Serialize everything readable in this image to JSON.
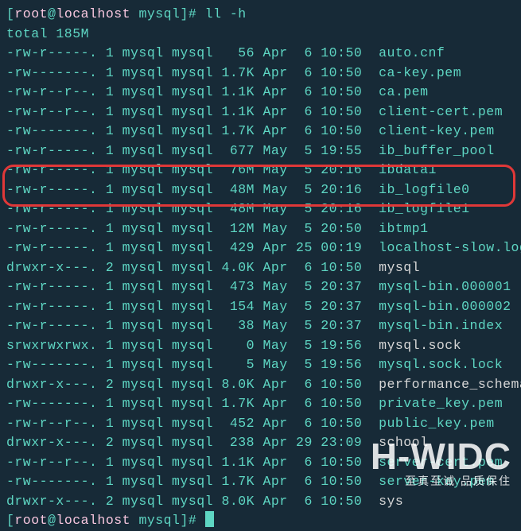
{
  "prompt": {
    "open": "[",
    "user": "root",
    "at": "@",
    "host": "localhost",
    "path": " mysql",
    "close": "]#",
    "command": " ll -h"
  },
  "total_line": "total 185M",
  "rows": [
    {
      "perm": "-rw-r-----.",
      "n": "1",
      "u": "mysql",
      "g": "mysql",
      "size": "  56",
      "dt": "Apr  6 10:50",
      "name": "auto.cnf",
      "cls": "fname-plain"
    },
    {
      "perm": "-rw-------.",
      "n": "1",
      "u": "mysql",
      "g": "mysql",
      "size": "1.7K",
      "dt": "Apr  6 10:50",
      "name": "ca-key.pem",
      "cls": "fname-plain"
    },
    {
      "perm": "-rw-r--r--.",
      "n": "1",
      "u": "mysql",
      "g": "mysql",
      "size": "1.1K",
      "dt": "Apr  6 10:50",
      "name": "ca.pem",
      "cls": "fname-plain"
    },
    {
      "perm": "-rw-r--r--.",
      "n": "1",
      "u": "mysql",
      "g": "mysql",
      "size": "1.1K",
      "dt": "Apr  6 10:50",
      "name": "client-cert.pem",
      "cls": "fname-plain"
    },
    {
      "perm": "-rw-------.",
      "n": "1",
      "u": "mysql",
      "g": "mysql",
      "size": "1.7K",
      "dt": "Apr  6 10:50",
      "name": "client-key.pem",
      "cls": "fname-plain"
    },
    {
      "perm": "-rw-r-----.",
      "n": "1",
      "u": "mysql",
      "g": "mysql",
      "size": " 677",
      "dt": "May  5 19:55",
      "name": "ib_buffer_pool",
      "cls": "fname-plain"
    },
    {
      "perm": "-rw-r-----.",
      "n": "1",
      "u": "mysql",
      "g": "mysql",
      "size": " 76M",
      "dt": "May  5 20:16",
      "name": "ibdata1",
      "cls": "fname-plain"
    },
    {
      "perm": "-rw-r-----.",
      "n": "1",
      "u": "mysql",
      "g": "mysql",
      "size": " 48M",
      "dt": "May  5 20:16",
      "name": "ib_logfile0",
      "cls": "fname-plain"
    },
    {
      "perm": "-rw-r-----.",
      "n": "1",
      "u": "mysql",
      "g": "mysql",
      "size": " 48M",
      "dt": "May  5 20:16",
      "name": "ib_logfile1",
      "cls": "fname-plain"
    },
    {
      "perm": "-rw-r-----.",
      "n": "1",
      "u": "mysql",
      "g": "mysql",
      "size": " 12M",
      "dt": "May  5 20:50",
      "name": "ibtmp1",
      "cls": "fname-plain"
    },
    {
      "perm": "-rw-r-----.",
      "n": "1",
      "u": "mysql",
      "g": "mysql",
      "size": " 429",
      "dt": "Apr 25 00:19",
      "name": "localhost-slow.log",
      "cls": "fname-plain"
    },
    {
      "perm": "drwxr-x---.",
      "n": "2",
      "u": "mysql",
      "g": "mysql",
      "size": "4.0K",
      "dt": "Apr  6 10:50",
      "name": "mysql",
      "cls": "fname-dir"
    },
    {
      "perm": "-rw-r-----.",
      "n": "1",
      "u": "mysql",
      "g": "mysql",
      "size": " 473",
      "dt": "May  5 20:37",
      "name": "mysql-bin.000001",
      "cls": "fname-plain"
    },
    {
      "perm": "-rw-r-----.",
      "n": "1",
      "u": "mysql",
      "g": "mysql",
      "size": " 154",
      "dt": "May  5 20:37",
      "name": "mysql-bin.000002",
      "cls": "fname-plain"
    },
    {
      "perm": "-rw-r-----.",
      "n": "1",
      "u": "mysql",
      "g": "mysql",
      "size": "  38",
      "dt": "May  5 20:37",
      "name": "mysql-bin.index",
      "cls": "fname-plain"
    },
    {
      "perm": "srwxrwxrwx.",
      "n": "1",
      "u": "mysql",
      "g": "mysql",
      "size": "   0",
      "dt": "May  5 19:56",
      "name": "mysql.sock",
      "cls": "fname-sock"
    },
    {
      "perm": "-rw-------.",
      "n": "1",
      "u": "mysql",
      "g": "mysql",
      "size": "   5",
      "dt": "May  5 19:56",
      "name": "mysql.sock.lock",
      "cls": "fname-plain"
    },
    {
      "perm": "drwxr-x---.",
      "n": "2",
      "u": "mysql",
      "g": "mysql",
      "size": "8.0K",
      "dt": "Apr  6 10:50",
      "name": "performance_schema",
      "cls": "fname-dir"
    },
    {
      "perm": "-rw-------.",
      "n": "1",
      "u": "mysql",
      "g": "mysql",
      "size": "1.7K",
      "dt": "Apr  6 10:50",
      "name": "private_key.pem",
      "cls": "fname-plain"
    },
    {
      "perm": "-rw-r--r--.",
      "n": "1",
      "u": "mysql",
      "g": "mysql",
      "size": " 452",
      "dt": "Apr  6 10:50",
      "name": "public_key.pem",
      "cls": "fname-plain"
    },
    {
      "perm": "drwxr-x---.",
      "n": "2",
      "u": "mysql",
      "g": "mysql",
      "size": " 238",
      "dt": "Apr 29 23:09",
      "name": "school",
      "cls": "fname-dir"
    },
    {
      "perm": "-rw-r--r--.",
      "n": "1",
      "u": "mysql",
      "g": "mysql",
      "size": "1.1K",
      "dt": "Apr  6 10:50",
      "name": "server-cert.pem",
      "cls": "fname-plain"
    },
    {
      "perm": "-rw-------.",
      "n": "1",
      "u": "mysql",
      "g": "mysql",
      "size": "1.7K",
      "dt": "Apr  6 10:50",
      "name": "server-key.pem",
      "cls": "fname-plain"
    },
    {
      "perm": "drwxr-x---.",
      "n": "2",
      "u": "mysql",
      "g": "mysql",
      "size": "8.0K",
      "dt": "Apr  6 10:50",
      "name": "sys",
      "cls": "fname-dir"
    }
  ],
  "watermark": {
    "big": "H-WIDC",
    "small": "至真至诚 品质保住"
  }
}
